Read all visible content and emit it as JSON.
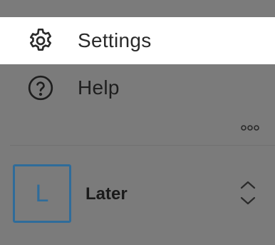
{
  "menu": {
    "items": [
      {
        "label": "Settings",
        "icon": "gear-icon",
        "highlighted": true
      },
      {
        "label": "Help",
        "icon": "question-circle-icon",
        "highlighted": false
      }
    ]
  },
  "more": {
    "icon": "more-horizontal-icon"
  },
  "workspace": {
    "avatar_letter": "L",
    "name": "Later",
    "switcher_icon": "chevron-up-down-icon"
  },
  "colors": {
    "overlay": "#7b7b7b",
    "highlight": "#ffffff",
    "accent": "#2f6c9a",
    "text": "#2a2a2a"
  }
}
